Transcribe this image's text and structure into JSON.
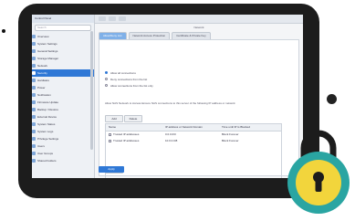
{
  "app": {
    "window_title": "Control Panel",
    "toolbar_title": "Network"
  },
  "sidebar": {
    "search_placeholder": "Search",
    "items": [
      {
        "label": "Overview"
      },
      {
        "label": "System Settings"
      },
      {
        "label": "General Settings"
      },
      {
        "label": "Storage Manager"
      },
      {
        "label": "Network"
      },
      {
        "label": "Security"
      },
      {
        "label": "Hardware"
      },
      {
        "label": "Power"
      },
      {
        "label": "Notification"
      },
      {
        "label": "Firmware Update"
      },
      {
        "label": "Backup / Restore"
      },
      {
        "label": "External Device"
      },
      {
        "label": "System Status"
      },
      {
        "label": "System Logs"
      },
      {
        "label": "Privilege Settings"
      },
      {
        "label": "Users"
      },
      {
        "label": "User Groups"
      },
      {
        "label": "Shared Folders"
      }
    ]
  },
  "tabs": [
    {
      "label": "Allow/Deny List"
    },
    {
      "label": "Network Access Protection"
    },
    {
      "label": "Certificate & Private Key"
    }
  ],
  "content": {
    "radio_options": [
      {
        "label": "Allow all connections",
        "selected": true
      },
      {
        "label": "Deny connections from the list",
        "selected": false
      },
      {
        "label": "Allow connections from the list only",
        "selected": false
      }
    ],
    "description": "Allow NAS Network to Access Ensure NAS connections to this server of the following IP address or network",
    "buttons": {
      "add": "Add",
      "delete": "Delete",
      "apply": "Apply"
    },
    "table": {
      "headers": [
        "Name",
        "IP address or Network Domain",
        "Time until IP is Blocked"
      ],
      "rows": [
        {
          "name": "Trusted IP addresses",
          "ip": "0.0.0.0/0",
          "time": "Block Forever"
        },
        {
          "name": "Trusted IP addresses",
          "ip": "10.0.0.0/8",
          "time": "Block Forever"
        }
      ]
    }
  },
  "colors": {
    "accent": "#2f78d6",
    "lock_ring": "#2aa5a2",
    "lock_body": "#f2d53c"
  },
  "icons": {
    "lock": "lock-icon",
    "keyhole": "keyhole-icon"
  }
}
